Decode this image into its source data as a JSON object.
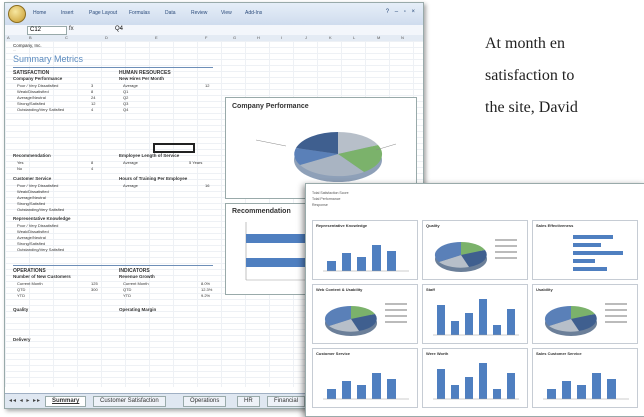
{
  "paragraph": {
    "lines": [
      "At month en",
      "satisfaction to",
      "the site, David"
    ]
  },
  "excel": {
    "ribbon_tabs": [
      "Home",
      "Insert",
      "Page Layout",
      "Formulas",
      "Data",
      "Review",
      "View",
      "Add-Ins"
    ],
    "name_box": "C12",
    "fx_label": "fx",
    "formula_value": "Q4",
    "column_letters": [
      "A",
      "B",
      "C",
      "D",
      "E",
      "F",
      "G",
      "H",
      "I",
      "J",
      "K",
      "L",
      "M",
      "N"
    ],
    "company_line": "Company, Inc.",
    "summary_title": "Summary Metrics",
    "sections": {
      "satisfaction": "SATISFACTION",
      "company_perf": "Company Performance",
      "human_resources": "HUMAN RESOURCES",
      "new_hires": "New Hires Per Month",
      "recommendation": "Recommendation",
      "tenure": "Employee Length of Service",
      "customer_service": "Customer Service",
      "training": "Hours of Training Per Employee",
      "rep_knowledge": "Representative Knowledge",
      "operations": "OPERATIONS",
      "new_customers": "Number of New Customers",
      "indicators": "INDICATORS",
      "revenue_growth": "Revenue Growth",
      "quality": "Quality",
      "operating_margin": "Operating Margin",
      "delivery": "Delivery"
    },
    "rating_labels": [
      "Poor / Very Dissatisfied",
      "Weak/Dissatisfied",
      "Average/Neutral",
      "Strong/Satisfied",
      "Outstanding/Very Satisfied"
    ],
    "perf_values": [
      "3",
      "8",
      "24",
      "12",
      "4"
    ],
    "yes_no": [
      [
        "Yes",
        "8"
      ],
      [
        "No",
        "4"
      ]
    ],
    "hr_rows": [
      [
        "Average",
        "12"
      ],
      [
        "Q1",
        ""
      ],
      [
        "Q2",
        ""
      ],
      [
        "Q3",
        ""
      ],
      [
        "Q4",
        ""
      ]
    ],
    "tenure_row": [
      "Average",
      "5 Years"
    ],
    "training_row": [
      "Average",
      "16"
    ],
    "ops_rows": [
      [
        "Current Month",
        "125"
      ],
      [
        "QTD",
        "300"
      ],
      [
        "YTD",
        ""
      ]
    ],
    "ind_rows": [
      [
        "Current Month",
        "8.0%"
      ],
      [
        "QTD",
        "12.3%"
      ],
      [
        "YTD",
        "9.2%"
      ]
    ],
    "sheet_tabs": [
      "Summary",
      "Customer Satisfaction",
      "Operations",
      "HR",
      "Financial"
    ],
    "charts": {
      "company_performance": "Company Performance",
      "recommendation": "Recommendation"
    }
  },
  "dashboard": {
    "header_rows": [
      "Total Satisfaction Score",
      "Total Performance",
      "Response"
    ],
    "panels": [
      "Representative Knowledge",
      "Quality",
      "Sales Effectiveness",
      "Web Content & Usability",
      "Staff",
      "Usability",
      "Customer Service",
      "Were Worth",
      "Sales Customer Service"
    ]
  },
  "colors": {
    "ribbon": "#cfdcee",
    "summary_title": "#5b8bbf",
    "pie_blue": "#5a80b8",
    "pie_green": "#7bb26b",
    "pie_grey": "#b7bfc9",
    "bar_blue": "#4f7fc0"
  }
}
